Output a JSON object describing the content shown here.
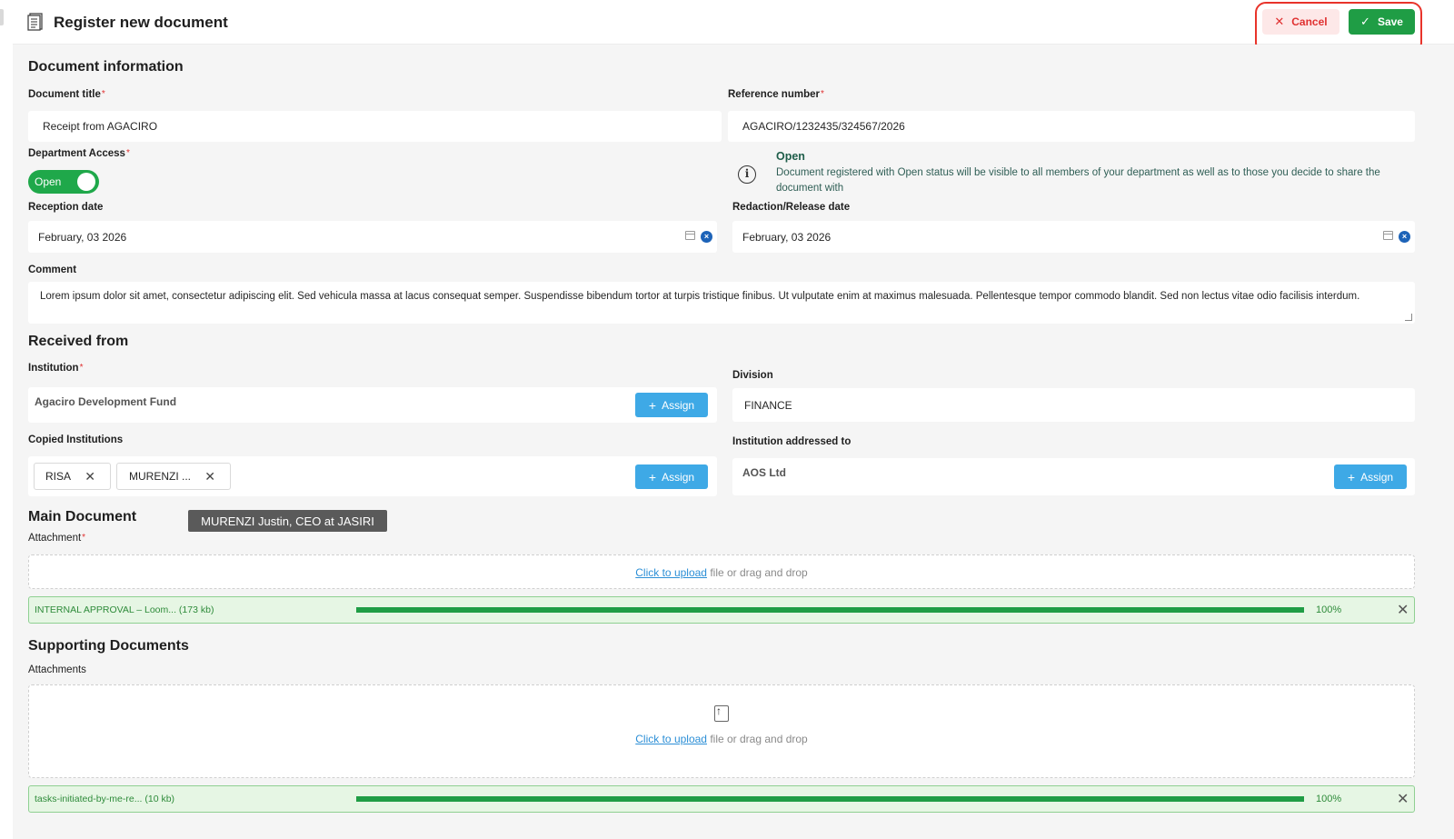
{
  "header": {
    "title": "Register new document",
    "cancel_label": "Cancel",
    "save_label": "Save"
  },
  "annotations": {
    "cancel_number": "1",
    "save_number": "2",
    "color": "#e8332a"
  },
  "document_information": {
    "section_title": "Document information",
    "document_title": {
      "label": "Document title",
      "value": "Receipt from AGACIRO"
    },
    "reference_number": {
      "label": "Reference number",
      "value": "AGACIRO/1232435/324567/2026"
    },
    "department_access": {
      "label": "Department Access",
      "toggle_label": "Open",
      "checked": true
    },
    "access_info": {
      "title": "Open",
      "text": "Document registered with Open status will be visible to all members of your department as well as to those you decide to share the document with"
    },
    "reception_date": {
      "label": "Reception date",
      "value": "February, 03 2026"
    },
    "release_date": {
      "label": "Redaction/Release date",
      "value": "February, 03 2026"
    },
    "comment": {
      "label": "Comment",
      "value": "Lorem ipsum dolor sit amet, consectetur adipiscing elit. Sed vehicula massa at lacus consequat semper. Suspendisse bibendum tortor at turpis tristique finibus. Ut vulputate enim at maximus malesuada. Pellentesque tempor commodo blandit. Sed non lectus vitae odio facilisis interdum."
    }
  },
  "received_from": {
    "section_title": "Received from",
    "institution": {
      "label": "Institution",
      "value": "Agaciro Development Fund",
      "assign_label": "Assign"
    },
    "division": {
      "label": "Division",
      "value": "FINANCE"
    },
    "copied_institutions": {
      "label": "Copied Institutions",
      "chips": [
        "RISA",
        "MURENZI ..."
      ],
      "assign_label": "Assign",
      "tooltip": "MURENZI Justin, CEO at JASIRI"
    },
    "addressed_to": {
      "label": "Institution addressed to",
      "value": "AOS Ltd",
      "assign_label": "Assign"
    }
  },
  "main_document": {
    "section_title": "Main Document",
    "attachment_label": "Attachment",
    "upload_link": "Click to upload",
    "upload_rest": " file or drag and drop",
    "file": {
      "name": "INTERNAL APPROVAL – Loom... (173 kb)",
      "progress": 100,
      "progress_label": "100%"
    }
  },
  "supporting_documents": {
    "section_title": "Supporting Documents",
    "attachment_label": "Attachments",
    "upload_link": "Click to upload",
    "upload_rest": " file or drag and drop",
    "file": {
      "name": "tasks-initiated-by-me-re... (10 kb)",
      "progress": 100,
      "progress_label": "100%"
    }
  },
  "colors": {
    "primary_green": "#1f9d45",
    "assign_blue": "#3ea9e6",
    "danger_red": "#e03131"
  }
}
